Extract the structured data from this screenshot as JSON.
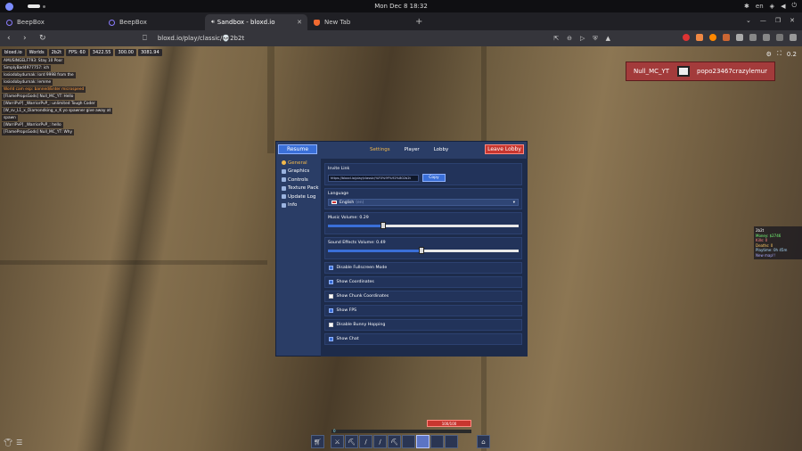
{
  "os": {
    "clock": "Mon Dec 8  18:32",
    "lang": "en"
  },
  "browser": {
    "tabs": [
      {
        "title": "BeepBox"
      },
      {
        "title": "BeepBox"
      },
      {
        "title": "Sandbox - bloxd.io"
      },
      {
        "title": "New Tab"
      }
    ],
    "url": "bloxd.io/play/classic/💀2b2t"
  },
  "hud": {
    "brand": "bloxd.io",
    "worlds": "Worlds",
    "server": "2b2t",
    "fps": "FPS: 60",
    "coords": [
      "3422.55",
      "300.00",
      "3081.94"
    ],
    "chat": [
      {
        "text": "AMUSINGELF793: Stay 10 Poor",
        "warn": false
      },
      {
        "text": "SimplyBad4977757: ich",
        "warn": false
      },
      {
        "text": "losiodobydurnak: lord 9998 from the",
        "warn": false
      },
      {
        "text": "losiodobydurnak: lemme",
        "warn": false
      },
      {
        "text": "World cam esp: banned/Enter microspeed",
        "warn": true
      },
      {
        "text": "[FlamePropsGods] Null_MC_YT: Hello",
        "warn": false
      },
      {
        "text": "[WarriPvP] _WarriorPvP_: unlimited Tough Coder",
        "warn": false
      },
      {
        "text": "[W_sv_L1_x_Diamondking_x_K yo spawner give away at",
        "warn": false
      },
      {
        "text": "spawn",
        "warn": false
      },
      {
        "text": "[WarriPvP] _WarriorPvP_: hello",
        "warn": false
      },
      {
        "text": "[FlamePropsGods] Null_MC_YT: Why",
        "warn": false
      }
    ],
    "opponent_left": "Null_MC_YT",
    "opponent_right": "popo23467crazylemur",
    "player_count": "0.2",
    "leaderboard": [
      "2b2t",
      "Money: $2746",
      "Kills: 0",
      "Deaths: 0",
      "Playtime: 0h 45m",
      "New map!!"
    ],
    "health": "100/100",
    "xp": "0"
  },
  "settings": {
    "resume": "Resume",
    "tabs": [
      "Settings",
      "Player",
      "Lobby"
    ],
    "active_tab": "Settings",
    "leave": "Leave Lobby",
    "sidebar": [
      "General",
      "Graphics",
      "Controls",
      "Texture Pack",
      "Update Log",
      "Info"
    ],
    "active_sidebar": "General",
    "invite_label": "Invite Link",
    "invite_url": "https://bloxd.io/play/classic/%F0%9F%92%802b2t",
    "copy": "Copy",
    "language_label": "Language",
    "language_value": "English",
    "language_sub": "(en)",
    "music_label": "Music Volume: 0.29",
    "music_value": 0.29,
    "sfx_label": "Sound Effects Volume: 0.49",
    "sfx_value": 0.49,
    "checks": [
      {
        "label": "Disable Fullscreen Mode",
        "on": true
      },
      {
        "label": "Show Coordinates",
        "on": true
      },
      {
        "label": "Show Chunk Coordinates",
        "on": false
      },
      {
        "label": "Show FPS",
        "on": true
      },
      {
        "label": "Disable Bunny Hopping",
        "on": false
      },
      {
        "label": "Show Chat",
        "on": true
      }
    ]
  }
}
